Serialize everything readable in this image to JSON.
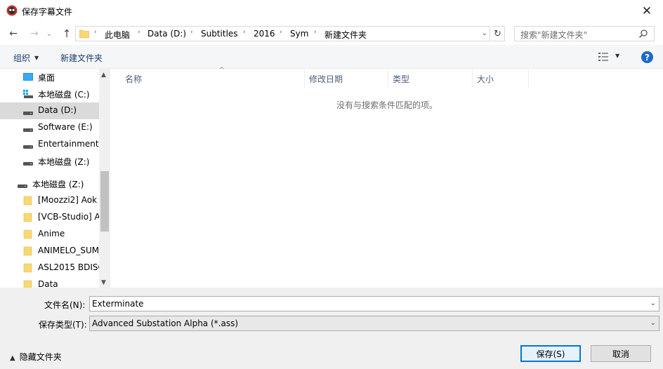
{
  "window": {
    "title": "保存字幕文件",
    "close_glyph": "✕"
  },
  "nav": {
    "back_glyph": "←",
    "forward_glyph": "→",
    "history_glyph": "⌄",
    "up_glyph": "↑",
    "refresh_glyph": "↻"
  },
  "address": {
    "crumbs": [
      "此电脑",
      "Data (D:)",
      "Subtitles",
      "2016",
      "Sym",
      "新建文件夹"
    ],
    "separator": "›",
    "dropdown_glyph": "⌄"
  },
  "search": {
    "placeholder": "搜索\"新建文件夹\""
  },
  "toolbar": {
    "organize_label": "组织",
    "organize_arrow": "▼",
    "new_folder_label": "新建文件夹",
    "view_dropdown": "▼",
    "help_label": "?"
  },
  "sidebar": {
    "items": [
      {
        "label": "桌面",
        "icon": "desktop-icon"
      },
      {
        "label": "本地磁盘 (C:)",
        "icon": "system-drive-icon"
      },
      {
        "label": "Data (D:)",
        "icon": "drive-icon",
        "selected": true
      },
      {
        "label": "Software (E:)",
        "icon": "drive-icon"
      },
      {
        "label": "Entertainment (",
        "icon": "drive-icon"
      },
      {
        "label": "本地磁盘 (Z:)",
        "icon": "drive-icon"
      },
      {
        "label": "本地磁盘 (Z:)",
        "icon": "drive-icon"
      },
      {
        "label": "[Moozzi2] Aok",
        "icon": "folder-icon"
      },
      {
        "label": "[VCB-Studio] A",
        "icon": "folder-icon"
      },
      {
        "label": "Anime",
        "icon": "folder-icon"
      },
      {
        "label": "ANIMELO_SUM",
        "icon": "folder-icon"
      },
      {
        "label": "ASL2015 BDISC",
        "icon": "folder-icon"
      },
      {
        "label": "Data",
        "icon": "folder-icon"
      }
    ],
    "scroll_up": "▲",
    "scroll_down": "▼"
  },
  "columns": {
    "name": "名称",
    "modified": "修改日期",
    "type": "类型",
    "size": "大小",
    "sort_glyph": "^"
  },
  "empty_message": "没有与搜索条件匹配的项。",
  "form": {
    "filename_label": "文件名(N):",
    "filename_value": "Exterminate",
    "filetype_label": "保存类型(T):",
    "filetype_value": "Advanced Substation Alpha (*.ass)",
    "dropdown_glyph": "⌄"
  },
  "footer": {
    "hide_folders_glyph": "▲",
    "hide_folders_label": "隐藏文件夹",
    "save_label": "保存(S)",
    "cancel_label": "取消"
  },
  "colors": {
    "accent": "#0078d7",
    "help": "#1b6ac9",
    "folder": "#f8d775"
  }
}
